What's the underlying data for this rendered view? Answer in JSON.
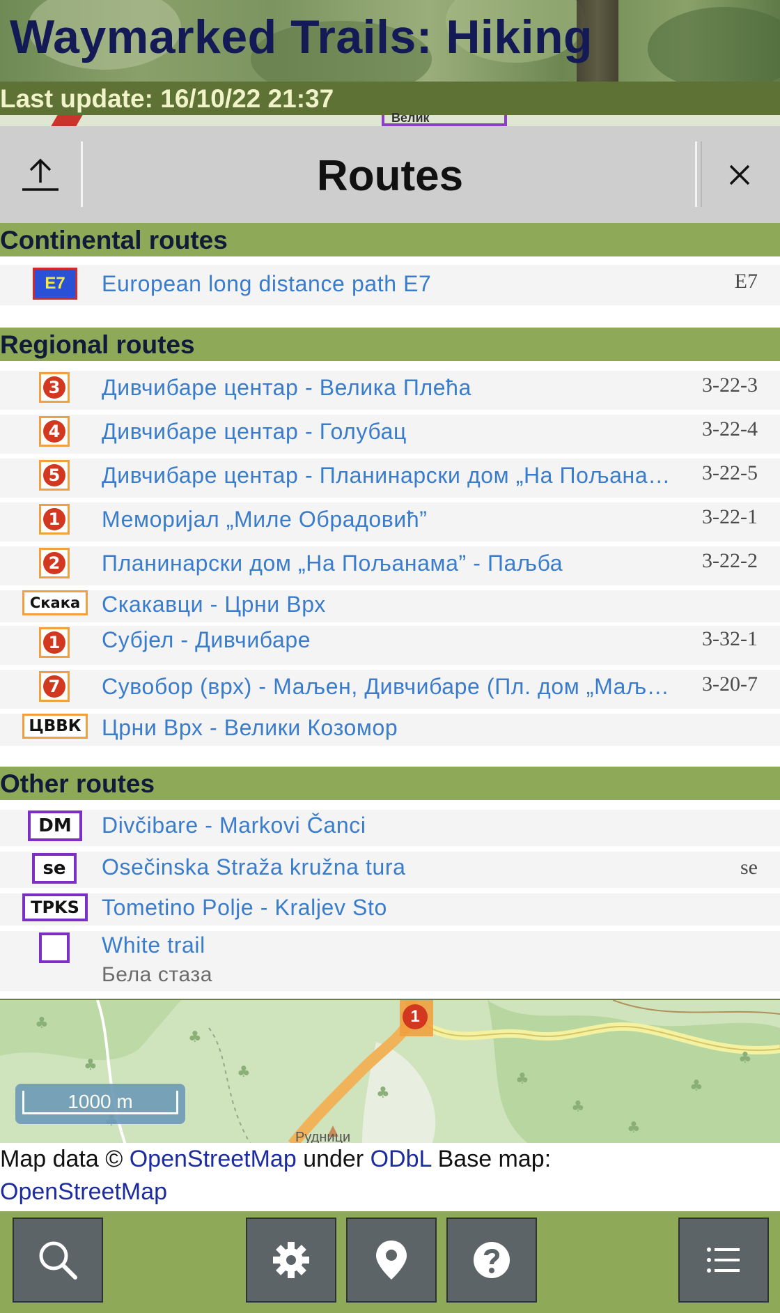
{
  "header": {
    "title": "Waymarked Trails: Hiking",
    "last_update": "Last update: 16/10/22 21:37",
    "map_fragment_text": "Велик"
  },
  "panel": {
    "title": "Routes",
    "upload_icon": "upload-icon",
    "close_icon": "close-icon"
  },
  "sections": {
    "continental": {
      "label": "Continental routes",
      "routes": [
        {
          "symbol": "E7",
          "name": "European long distance path E7",
          "ref": "E7"
        }
      ]
    },
    "regional": {
      "label": "Regional routes",
      "routes": [
        {
          "symbol": "3",
          "name": "Дивчибаре центар - Велика Плећа",
          "ref": "3-22-3"
        },
        {
          "symbol": "4",
          "name": "Дивчибаре центар - Голубац",
          "ref": "3-22-4"
        },
        {
          "symbol": "5",
          "name": "Дивчибаре центар - Планинарски дом „На Пољанама”",
          "ref": "3-22-5"
        },
        {
          "symbol": "1",
          "name": "Меморијал „Миле Обрадовић”",
          "ref": "3-22-1"
        },
        {
          "symbol": "2",
          "name": "Планинарски дом „На Пољанама” - Паљба",
          "ref": "3-22-2"
        },
        {
          "symbol": "Скака",
          "name": "Скакавци - Црни Врх",
          "ref": ""
        },
        {
          "symbol": "1",
          "name": "Субјел - Дивчибаре",
          "ref": "3-32-1"
        },
        {
          "symbol": "7",
          "name": "Сувобор (врх) - Маљен, Дивчибаре (Пл. дом „Маљен”)",
          "ref": "3-20-7"
        },
        {
          "symbol": "ЦВВК",
          "name": "Црни Врх - Велики Козомор",
          "ref": ""
        }
      ]
    },
    "other": {
      "label": "Other routes",
      "routes": [
        {
          "symbol": "DM",
          "name": "Divčibare - Markovi Čanci",
          "ref": ""
        },
        {
          "symbol": "se",
          "name": "Osečinska Straža kružna tura",
          "ref": "se"
        },
        {
          "symbol": "TPKS",
          "name": "Tometino Polje - Kraljev Sto",
          "ref": ""
        },
        {
          "symbol": "",
          "name": "White trail",
          "subtitle": "Бела стаза",
          "ref": ""
        }
      ]
    }
  },
  "map": {
    "scale_label": "1000 m",
    "marker_number": "1",
    "place_label": "Рудници"
  },
  "attribution": {
    "prefix": "Map data © ",
    "osm_link": "OpenStreetMap",
    "under": " under ",
    "odbl_link": "ODbL",
    "base_map": " Base map:",
    "base_link": "OpenStreetMap"
  },
  "toolbar": {
    "buttons": [
      "search-icon",
      "gear-icon",
      "location-pin-icon",
      "help-icon",
      "list-icon"
    ]
  },
  "colors": {
    "section_bar": "#8eaa58",
    "header_text": "#141a55",
    "update_bar": "#5e7236",
    "link": "#3a7ccc",
    "route_badge_red": "#d2381f",
    "route_badge_border": "#f0a040",
    "other_border": "#7b2fc4",
    "toolbar_button": "#5c6468"
  }
}
